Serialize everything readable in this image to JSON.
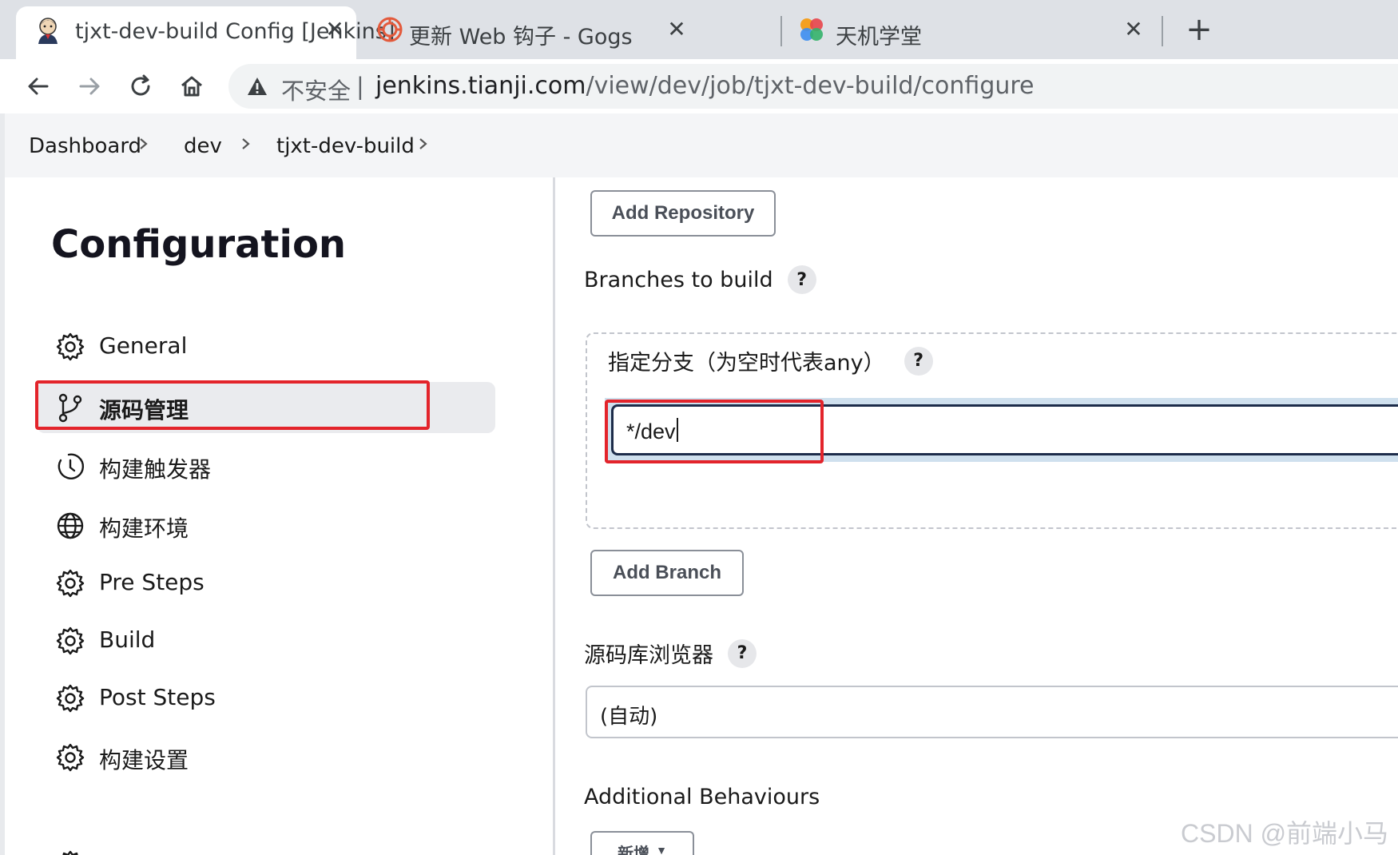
{
  "browser": {
    "tabs": [
      {
        "title": "tjxt-dev-build Config [Jenkins]",
        "favicon": "jenkins-butler-icon",
        "active": true
      },
      {
        "title": "更新 Web 钩子 - Gogs",
        "favicon": "gogs-icon",
        "active": false
      },
      {
        "title": "天机学堂",
        "favicon": "tianji-icon",
        "active": false
      }
    ],
    "close_glyph": "✕",
    "new_tab_glyph": "+",
    "address": {
      "security_label": "不安全",
      "separator": "|",
      "host": "jenkins.tianji.com",
      "path": "/view/dev/job/tjxt-dev-build/configure"
    }
  },
  "breadcrumb": [
    "Dashboard",
    "dev",
    "tjxt-dev-build"
  ],
  "sidebar": {
    "title": "Configuration",
    "items": [
      {
        "label": "General",
        "icon": "gear-icon"
      },
      {
        "label": "源码管理",
        "icon": "branch-icon",
        "active": true
      },
      {
        "label": "构建触发器",
        "icon": "clock-icon"
      },
      {
        "label": "构建环境",
        "icon": "globe-icon"
      },
      {
        "label": "Pre Steps",
        "icon": "gear-icon"
      },
      {
        "label": "Build",
        "icon": "gear-icon"
      },
      {
        "label": "Post Steps",
        "icon": "gear-icon"
      },
      {
        "label": "构建设置",
        "icon": "gear-icon"
      }
    ]
  },
  "main": {
    "add_repository": "Add Repository",
    "branches_label": "Branches to build",
    "branch_spec_label": "指定分支（为空时代表any）",
    "branch_value": "*/dev",
    "add_branch": "Add Branch",
    "browser_label": "源码库浏览器",
    "browser_value": "(自动)",
    "additional_label": "Additional Behaviours",
    "add_new": "新增",
    "help_glyph": "?"
  },
  "watermark": "CSDN @前端小马",
  "colors": {
    "highlight": "#e3242b",
    "input_focus": "#1d2c4a",
    "focus_ring": "#cfe0ee"
  }
}
